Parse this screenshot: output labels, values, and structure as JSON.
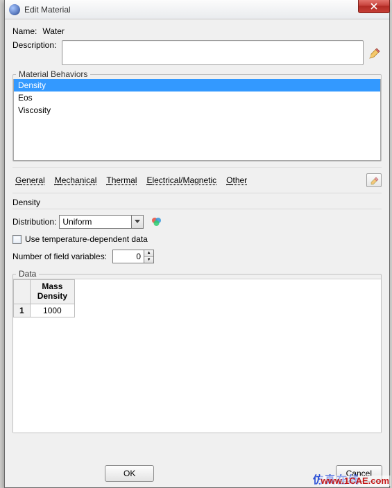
{
  "window": {
    "title": "Edit Material"
  },
  "name": {
    "label": "Name:",
    "value": "Water"
  },
  "description": {
    "label": "Description:",
    "value": ""
  },
  "behaviors": {
    "legend": "Material Behaviors",
    "items": [
      "Density",
      "Eos",
      "Viscosity"
    ],
    "selectedIndex": 0
  },
  "tabs": {
    "general": "General",
    "mechanical": "Mechanical",
    "thermal": "Thermal",
    "electrical": "Electrical/Magnetic",
    "other": "Other"
  },
  "density": {
    "title": "Density",
    "distribution_label": "Distribution:",
    "distribution_value": "Uniform",
    "tempdep_label": "Use temperature-dependent data",
    "fieldvars_label": "Number of field variables:",
    "fieldvars_value": "0",
    "data_legend": "Data",
    "header_line1": "Mass",
    "header_line2": "Density",
    "row_index": "1",
    "row_value": "1000"
  },
  "buttons": {
    "ok": "OK",
    "cancel": "Cancel"
  },
  "watermark": {
    "cn": "仿真在线",
    "url": "www.1CAE.com"
  }
}
